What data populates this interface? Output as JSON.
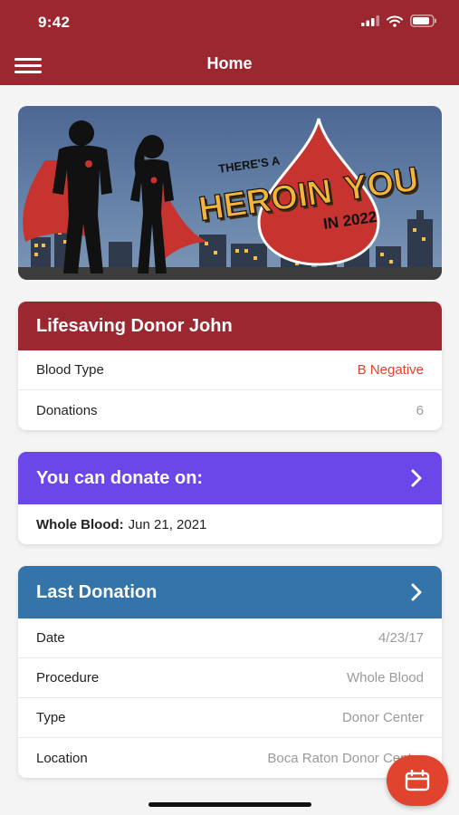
{
  "status_bar": {
    "time": "9:42"
  },
  "nav": {
    "title": "Home"
  },
  "hero": {
    "line1": "THERE'S A",
    "line2a": "HERO",
    "line2b": "IN",
    "line2c": "YOU",
    "line3": "IN 2022"
  },
  "donor_card": {
    "title": "Lifesaving Donor John",
    "rows": [
      {
        "label": "Blood Type",
        "value": "B Negative"
      },
      {
        "label": "Donations",
        "value": "6"
      }
    ]
  },
  "donate_card": {
    "title": "You can donate on:",
    "item_label": "Whole Blood:",
    "item_date": "Jun 21, 2021"
  },
  "last_donation": {
    "title": "Last Donation",
    "rows": [
      {
        "label": "Date",
        "value": "4/23/17"
      },
      {
        "label": "Procedure",
        "value": "Whole Blood"
      },
      {
        "label": "Type",
        "value": "Donor Center"
      },
      {
        "label": "Location",
        "value": "Boca Raton Donor Center"
      }
    ]
  },
  "colors": {
    "brand": "#9b2830",
    "donate_header": "#6b46e8",
    "last_donation_header": "#3474a9",
    "blood_type_value": "#e0432e",
    "fab": "#e0432e"
  },
  "icons": {
    "menu": "hamburger-icon",
    "fab": "calendar-icon",
    "chevron": "chevron-right-icon"
  }
}
